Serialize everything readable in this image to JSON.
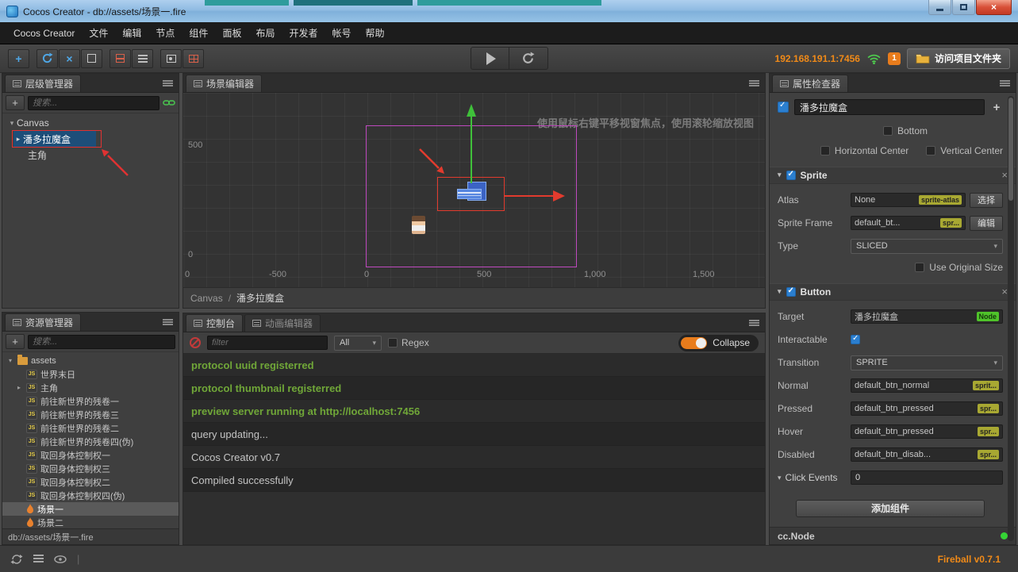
{
  "glyphs": {
    "plus": "+",
    "caret_down": "▾",
    "caret_right": "▸",
    "close": "×",
    "slash": "/",
    "divider": "|"
  },
  "window": {
    "title": "Cocos Creator - db://assets/场景一.fire"
  },
  "menu": {
    "items": [
      "Cocos Creator",
      "文件",
      "编辑",
      "节点",
      "组件",
      "面板",
      "布局",
      "开发者",
      "帐号",
      "帮助"
    ]
  },
  "toolbar": {
    "preview_address": "192.168.191.1:7456",
    "device_count": "1",
    "open_project_folder": "访问项目文件夹"
  },
  "hierarchy": {
    "tab": "层级管理器",
    "search_placeholder": "搜索...",
    "nodes": [
      "Canvas",
      "潘多拉魔盒",
      "主角"
    ]
  },
  "assets": {
    "tab": "资源管理器",
    "search_placeholder": "搜索...",
    "root_label": "assets",
    "js_badge": "JS",
    "items": [
      "世界末日",
      "主角",
      "前往新世界的残卷一",
      "前往新世界的残卷三",
      "前往新世界的残卷二",
      "前往新世界的残卷四(伪)",
      "取回身体控制权一",
      "取回身体控制权三",
      "取回身体控制权二",
      "取回身体控制权四(伪)",
      "场景一",
      "场景二"
    ],
    "path": "db://assets/场景一.fire"
  },
  "scene": {
    "tab": "场景编辑器",
    "hint": "使用鼠标右键平移视窗焦点，使用滚轮缩放视图",
    "ruler_y": [
      "500",
      "0"
    ],
    "ruler_x": [
      "0",
      "-500",
      "0",
      "500",
      "1,000",
      "1,500"
    ],
    "breadcrumb_root": "Canvas",
    "breadcrumb_current": "潘多拉魔盒"
  },
  "console": {
    "tab": "控制台",
    "animation_tab": "动画编辑器",
    "filter_placeholder": "filter",
    "level_filter": "All",
    "regex_label": "Regex",
    "collapse_label": "Collapse",
    "logs": [
      {
        "text": "protocol uuid registerred",
        "level": "success"
      },
      {
        "text": "protocol thumbnail registerred",
        "level": "success"
      },
      {
        "text": "preview server running at http://localhost:7456",
        "level": "success"
      },
      {
        "text": "query updating...",
        "level": "info"
      },
      {
        "text": "Cocos Creator v0.7",
        "level": "info"
      },
      {
        "text": "Compiled successfully",
        "level": "info"
      }
    ]
  },
  "inspector": {
    "tab": "属性检查器",
    "node_name": "潘多拉魔盒",
    "layout": {
      "bottom": "Bottom",
      "horizontal_center": "Horizontal Center",
      "vertical_center": "Vertical Center"
    },
    "sprite": {
      "title": "Sprite",
      "atlas_label": "Atlas",
      "atlas_value": "None",
      "atlas_badge": "sprite-atlas",
      "atlas_button": "选择",
      "frame_label": "Sprite Frame",
      "frame_value": "default_bt...",
      "frame_badge": "spr...",
      "frame_button": "编辑",
      "type_label": "Type",
      "type_value": "SLICED",
      "use_original_size": "Use Original Size"
    },
    "button": {
      "title": "Button",
      "target_label": "Target",
      "target_value": "潘多拉魔盒",
      "target_badge": "Node",
      "interactable_label": "Interactable",
      "transition_label": "Transition",
      "transition_value": "SPRITE",
      "normal_label": "Normal",
      "normal_value": "default_btn_normal",
      "normal_badge": "sprit...",
      "pressed_label": "Pressed",
      "pressed_value": "default_btn_pressed",
      "pressed_badge": "spr...",
      "hover_label": "Hover",
      "hover_value": "default_btn_pressed",
      "hover_badge": "spr...",
      "disabled_label": "Disabled",
      "disabled_value": "default_btn_disab...",
      "disabled_badge": "spr...",
      "click_events_label": "Click Events",
      "click_events_value": "0"
    },
    "add_component": "添加组件",
    "node_type": "cc.Node"
  },
  "statusbar": {
    "version": "Fireball v0.7.1"
  },
  "colors": {
    "accent_orange": "#f08a18",
    "console_green": "#70a738",
    "selection_blue": "#1d4e79",
    "badge_yellow": "#a8a832",
    "badge_green": "#4fc32a",
    "gizmo_green": "#3fc03a",
    "gizmo_red": "#e23b2e",
    "design_border_magenta": "#c04ac0"
  }
}
